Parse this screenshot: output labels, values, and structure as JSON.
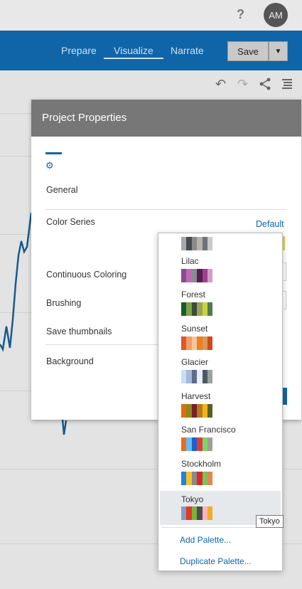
{
  "topbar": {
    "help": "?",
    "avatar": "AM"
  },
  "nav": {
    "tabs": [
      "Prepare",
      "Visualize",
      "Narrate"
    ],
    "save": "Save"
  },
  "dialog": {
    "title": "Project Properties",
    "section": "General",
    "labels": [
      "Color Series",
      "Continuous Coloring",
      "Brushing",
      "Save thumbnails",
      "Background"
    ],
    "color_series_link": "Default"
  },
  "palettes": [
    {
      "name": "",
      "colors": [
        "#a5a9ad",
        "#474b4f",
        "#8c8a86",
        "#b9b3ae",
        "#6c737b",
        "#c8cacb"
      ]
    },
    {
      "name": "Lilac",
      "colors": [
        "#8a4b92",
        "#c06ab5",
        "#8b8b92",
        "#53214f",
        "#9d3f8e",
        "#d89cc8"
      ]
    },
    {
      "name": "Forest",
      "colors": [
        "#1e5b2b",
        "#7ea344",
        "#3b4b3a",
        "#9aa15b",
        "#c8d43a",
        "#4c7b4c"
      ]
    },
    {
      "name": "Sunset",
      "colors": [
        "#e1552c",
        "#f2a062",
        "#f6c69e",
        "#ed7f1e",
        "#d99859",
        "#d24718"
      ]
    },
    {
      "name": "Glacier",
      "colors": [
        "#c5dff4",
        "#a9b9d4",
        "#5d6c8c",
        "#e8eef5",
        "#4d5866",
        "#97a4a1"
      ]
    },
    {
      "name": "Harvest",
      "colors": [
        "#e06c14",
        "#8c8a16",
        "#7a1e2a",
        "#b07c1e",
        "#f2b319",
        "#5b5f24"
      ]
    },
    {
      "name": "San Francisco",
      "colors": [
        "#ef6b13",
        "#62bdf3",
        "#1e5fc8",
        "#e3393b",
        "#7cd46a",
        "#a29f92"
      ]
    },
    {
      "name": "Stockholm",
      "colors": [
        "#1f85d9",
        "#f6c22b",
        "#8a8a8a",
        "#d92b24",
        "#7cc35c",
        "#e5874c"
      ]
    },
    {
      "name": "Tokyo",
      "colors": [
        "#7ba2c2",
        "#e5362a",
        "#7ab23c",
        "#4d4d4d",
        "#f4b4c2",
        "#f5ab21"
      ]
    }
  ],
  "popup_links": [
    "Add Palette...",
    "Duplicate Palette..."
  ],
  "tooltip": "Tokyo"
}
